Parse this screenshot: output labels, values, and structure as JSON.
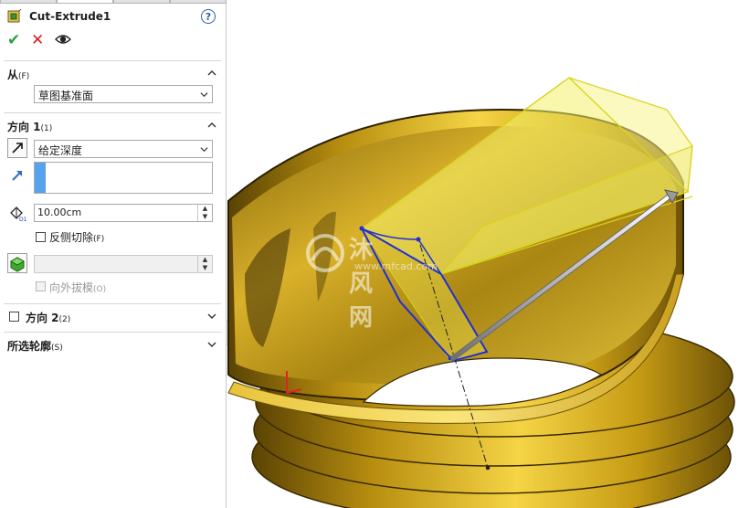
{
  "feature": {
    "title": "Cut-Extrude1",
    "help_symbol": "?",
    "icons": [
      "cut-extrude-icon",
      "ok-check-icon",
      "cancel-x-icon",
      "preview-eye-icon",
      "help-icon"
    ]
  },
  "from_section": {
    "title": "从",
    "key": "(F)",
    "value": "草图基准面"
  },
  "direction1": {
    "title": "方向 1",
    "key": "(1)",
    "end_condition": "给定深度",
    "depth": "10.00cm",
    "flip_label": "反侧切除",
    "flip_key": "(F)",
    "draft_value": "",
    "draft_outward_label": "向外拔模",
    "draft_outward_key": "(O)"
  },
  "direction2": {
    "title": "方向 2",
    "key": "(2)"
  },
  "selected_contours": {
    "title": "所选轮廓",
    "key": "(S)"
  },
  "watermark": {
    "brand": "沐风网",
    "url": "www.mfcad.com"
  },
  "colors": {
    "accent_blue": "#56a2ec",
    "ok_green": "#27a334",
    "cancel_red": "#d81e1e",
    "gold": "#c9a21c",
    "preview_yellow": "#f4f06a",
    "sketch_blue": "#1f2fd6"
  }
}
